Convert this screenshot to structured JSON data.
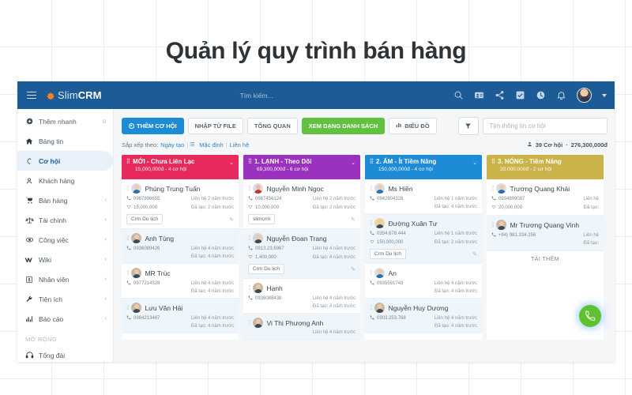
{
  "page": {
    "title": "Quản lý quy trình bán hàng"
  },
  "topbar": {
    "brand_light": "Slim",
    "brand_bold": "CRM",
    "search_placeholder": "Tìm kiếm..."
  },
  "sidebar": {
    "quick_add": "Thêm nhanh",
    "section_label": "MỞ RỘNG",
    "items": [
      {
        "label": "Bảng tin",
        "icon": "home-icon",
        "chevron": ""
      },
      {
        "label": "Cơ hội",
        "icon": "opportunity-icon",
        "chevron": ""
      },
      {
        "label": "Khách hàng",
        "icon": "customer-icon",
        "chevron": ""
      },
      {
        "label": "Bán hàng",
        "icon": "cart-icon",
        "chevron": "‹"
      },
      {
        "label": "Tài chính",
        "icon": "scale-icon",
        "chevron": "‹"
      },
      {
        "label": "Công việc",
        "icon": "task-icon",
        "chevron": "‹"
      },
      {
        "label": "Wiki",
        "icon": "wiki-icon",
        "chevron": "‹"
      },
      {
        "label": "Nhân viên",
        "icon": "employee-icon",
        "chevron": "‹"
      },
      {
        "label": "Tiện ích",
        "icon": "wrench-icon",
        "chevron": "‹"
      },
      {
        "label": "Báo cáo",
        "icon": "chart-icon",
        "chevron": "‹"
      }
    ],
    "extended": {
      "label": "Tổng đài",
      "icon": "headset-icon"
    }
  },
  "toolbar": {
    "add_opportunity": "THÊM CƠ HỘI",
    "import_file": "NHẬP TỪ FILE",
    "overview": "TỔNG QUAN",
    "list_view": "XEM DẠNG DANH SÁCH",
    "chart_view": "BIỂU ĐỒ",
    "search_placeholder": "Tìm thông tin cơ hội"
  },
  "sortbar": {
    "label": "Sắp xếp theo:",
    "link_date": "Ngày tạo",
    "link_default": "Mặc định",
    "link_contact": "Liên hệ",
    "count": "39 Cơ hội",
    "dot": "·",
    "total": "276,300,000đ"
  },
  "colors": {
    "col1": "#e8295e",
    "col2": "#9b31bf",
    "col3": "#1e8bd6",
    "col4": "#cbb349",
    "primary": "#1e8bd6",
    "green": "#63c141",
    "navy": "#1c5b96"
  },
  "columns": [
    {
      "title": "MỚI - Chưa Liên Lạc",
      "subtitle": "15,000,000đ - 4 cơ hội",
      "cards": [
        {
          "name": "Phùng Trung Tuấn",
          "phone": "0987896655",
          "amount": "15,000,000",
          "contacted": "Liên hệ 2 năm trước",
          "created": "Đã tạo: 2 năm trước",
          "tag": "Crm Du lịch"
        },
        {
          "name": "Anh Tùng",
          "phone": "0936089426",
          "amount": "",
          "contacted": "Liên hệ 4 năm trước",
          "created": "Đã tạo: 4 năm trước",
          "tag": ""
        },
        {
          "name": "MR Trúc",
          "phone": "0977214328",
          "amount": "",
          "contacted": "Liên hệ 4 năm trước",
          "created": "Đã tạo: 4 năm trước",
          "tag": ""
        },
        {
          "name": "Lưu Văn Hải",
          "phone": "0984213467",
          "amount": "",
          "contacted": "Liên hệ 4 năm trước",
          "created": "Đã tạo: 4 năm trước",
          "tag": ""
        }
      ]
    },
    {
      "title": "1. LẠNH - Theo Dõi",
      "subtitle": "69,300,000đ - 6 cơ hội",
      "cards": [
        {
          "name": "Nguyễn Minh Ngọc",
          "phone": "0987456124",
          "amount": "10,000,000",
          "contacted": "Liên hệ 2 năm trước",
          "created": "Đã tạo: 2 năm trước",
          "tag": "slimcrm"
        },
        {
          "name": "Nguyễn Đoan Trang",
          "phone": "0913.23.6967",
          "amount": "1,400,000",
          "contacted": "Liên hệ 4 năm trước",
          "created": "Đã tạo: 4 năm trước",
          "tag": "Crm Du lịch"
        },
        {
          "name": "Hạnh",
          "phone": "0936088438",
          "amount": "",
          "contacted": "Liên hệ 4 năm trước",
          "created": "Đã tạo: 4 năm trước",
          "tag": ""
        },
        {
          "name": "Vi Thị Phương Anh",
          "phone": "",
          "amount": "",
          "contacted": "Liên hệ 4 năm trước",
          "created": "",
          "tag": ""
        }
      ]
    },
    {
      "title": "2. ẤM - Ít Tiềm Năng",
      "subtitle": "150,000,000đ - 4 cơ hội",
      "cards": [
        {
          "name": "Ms Hiền",
          "phone": "0942804328",
          "amount": "",
          "contacted": "Liên hệ 1 năm trước",
          "created": "Đã tạo: 4 năm trước",
          "tag": ""
        },
        {
          "name": "Đường Xuân Tư",
          "phone": "0354.678.444",
          "amount": "150,000,000",
          "contacted": "Liên hệ 1 năm trước",
          "created": "Đã tạo: 2 năm trước",
          "tag": "Crm Du lịch"
        },
        {
          "name": "An",
          "phone": "0935591743",
          "amount": "",
          "contacted": "Liên hệ 4 năm trước",
          "created": "Đã tạo: 4 năm trước",
          "tag": ""
        },
        {
          "name": "Nguyễn Huy Dương",
          "phone": "0903.253.768",
          "amount": "",
          "contacted": "Liên hệ 4 năm trước",
          "created": "Đã tạo: 4 năm trước",
          "tag": ""
        }
      ]
    },
    {
      "title": "3. NÓNG - Tiềm Năng",
      "subtitle": "20,000,000đ - 2 cơ hội",
      "cards": [
        {
          "name": "Trương Quang Khải",
          "phone": "0934809087",
          "amount": "20,000,000",
          "contacted": "Liên hệ",
          "created": "Đã tạo:",
          "tag": ""
        },
        {
          "name": "Mr Trương Quang Vinh",
          "phone": "+84) 981.334.256",
          "amount": "",
          "contacted": "Liên hệ",
          "created": "Đã tạo:",
          "tag": ""
        }
      ],
      "load_more": "TẢI THÊM"
    }
  ]
}
